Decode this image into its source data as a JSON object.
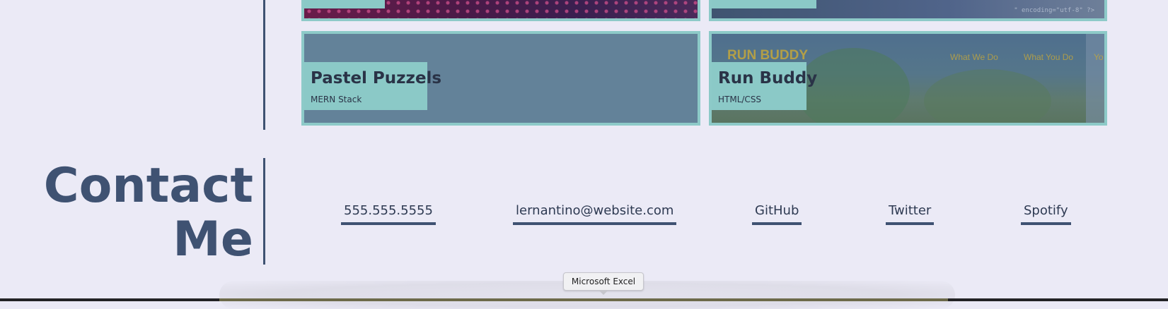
{
  "projects": [
    {
      "title": "Pastel Puzzels",
      "stack": "MERN Stack"
    },
    {
      "title": "Run Buddy",
      "stack": "HTML/CSS"
    }
  ],
  "runbuddy_screenshot": {
    "brand": "RUN BUDDY",
    "nav": [
      "What We Do",
      "What You Do",
      "Yo"
    ]
  },
  "code_snippet": "\" encoding=\"utf-8\" ?>",
  "contact": {
    "heading_line1": "Contact",
    "heading_line2": "Me",
    "links": [
      {
        "id": "phone",
        "label": "555.555.5555"
      },
      {
        "id": "email",
        "label": "lernantino@website.com"
      },
      {
        "id": "github",
        "label": "GitHub"
      },
      {
        "id": "twitter",
        "label": "Twitter"
      },
      {
        "id": "spotify",
        "label": "Spotify"
      }
    ]
  },
  "dock": {
    "tooltip": "Microsoft Excel"
  },
  "colors": {
    "background": "#ebeaf6",
    "accent": "#3f5272",
    "caption": "#8bc9c7"
  }
}
